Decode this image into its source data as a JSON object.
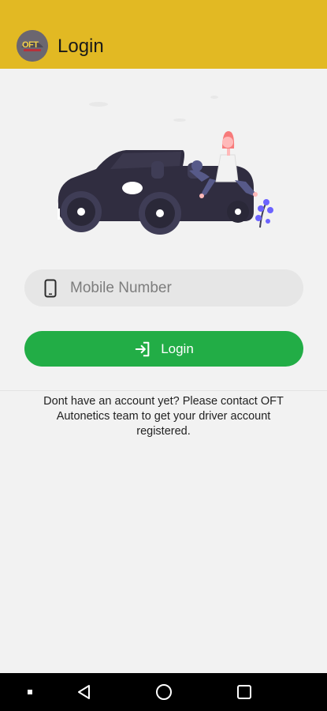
{
  "app_bar": {
    "title": "Login",
    "logo_text": "OFT",
    "background_color": "#e2b923"
  },
  "hero": {
    "illustration": "person-sitting-on-convertible-car"
  },
  "form": {
    "mobile_placeholder": "Mobile Number",
    "mobile_value": "",
    "phone_icon": "smartphone-icon",
    "login_label": "Login",
    "login_icon": "sign-in-icon",
    "login_color": "#22ad46"
  },
  "info_text": "Dont have an account yet? Please contact OFT Autonetics team to get your driver account registered.",
  "nav_bar": {
    "items": [
      "square-dot-icon",
      "back-triangle-icon",
      "home-circle-icon",
      "recents-square-icon"
    ]
  }
}
